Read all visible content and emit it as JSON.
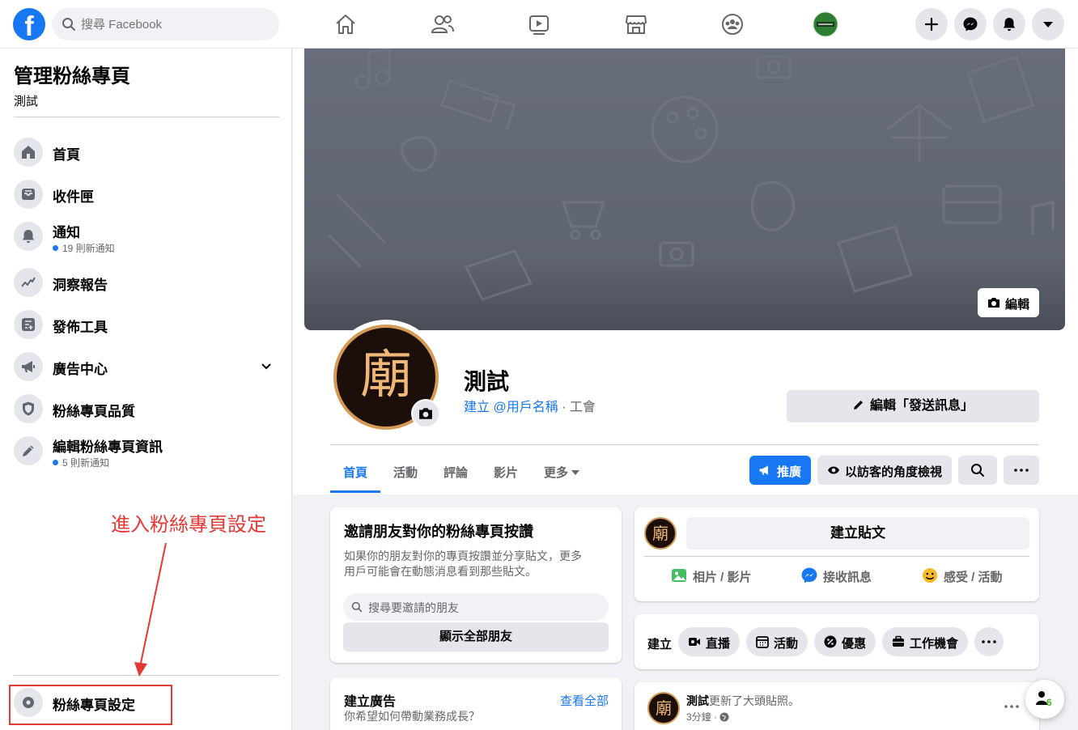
{
  "topbar": {
    "logo": "f",
    "search_placeholder": "搜尋 Facebook",
    "nav_icons": [
      "home-icon",
      "friends-icon",
      "watch-icon",
      "marketplace-icon",
      "groups-icon",
      "page-avatar-icon"
    ],
    "action_icons": [
      "plus-icon",
      "messenger-icon",
      "bell-icon",
      "dropdown-icon"
    ]
  },
  "sidebar": {
    "title": "管理粉絲專頁",
    "subtitle": "測試",
    "items": [
      {
        "label": "首頁",
        "icon": "home-icon"
      },
      {
        "label": "收件匣",
        "icon": "inbox-icon"
      },
      {
        "label": "通知",
        "icon": "bell-icon",
        "sub": "19 則新通知"
      },
      {
        "label": "洞察報告",
        "icon": "insights-icon"
      },
      {
        "label": "發佈工具",
        "icon": "publishing-tools-icon"
      },
      {
        "label": "廣告中心",
        "icon": "megaphone-icon"
      },
      {
        "label": "粉絲專頁品質",
        "icon": "shield-icon"
      },
      {
        "label": "編輯粉絲專頁資訊",
        "icon": "pencil-icon",
        "sub": "5 則新通知"
      }
    ],
    "settings_label": "粉絲專頁設定",
    "annotation": "進入粉絲專頁設定"
  },
  "page": {
    "cover_edit": "編輯",
    "avatar_char": "廟",
    "name": "測試",
    "username_link": "建立 @用戶名稱",
    "meta_sep": " · ",
    "category": "工會",
    "edit_send_message": "編輯「發送訊息」",
    "tabs": [
      "首頁",
      "活動",
      "評論",
      "影片",
      "更多"
    ],
    "promote": "推廣",
    "view_as_visitor": "以訪客的角度檢視"
  },
  "invite_card": {
    "title": "邀請朋友對你的粉絲專頁按讚",
    "text_1": "如果你的朋友對你的專頁按讚並分享貼文，更多",
    "text_2": "用戶可能會在動態消息看到那些貼文。",
    "search_placeholder": "搜尋要邀請的朋友",
    "show_all": "顯示全部朋友"
  },
  "ad_card": {
    "title": "建立廣告",
    "see_all": "查看全部",
    "subtitle": "你希望如何帶動業務成長？"
  },
  "composer": {
    "create_post": "建立貼文",
    "actions": [
      "相片 / 影片",
      "接收訊息",
      "感受 / 活動"
    ]
  },
  "create_row": {
    "label": "建立",
    "chips": [
      "直播",
      "活動",
      "優惠",
      "工作機會"
    ]
  },
  "feed_post": {
    "author": "測試",
    "action": "更新了大頭貼照。",
    "time": "3分鐘 ·"
  },
  "fab": {
    "badge": "6"
  },
  "colors": {
    "brand": "#1877f2",
    "annotation": "#e53935",
    "avatar_ring": "#d49a55"
  }
}
